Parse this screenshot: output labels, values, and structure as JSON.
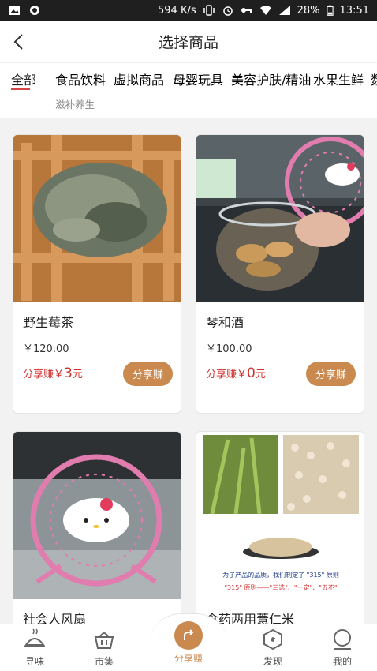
{
  "status_bar": {
    "speed": "594 K/s",
    "battery": "28%",
    "time": "13:51"
  },
  "header": {
    "title": "选择商品"
  },
  "tabs": [
    {
      "label": "全部"
    },
    {
      "label": "食品饮料"
    },
    {
      "label": "虚拟商品"
    },
    {
      "label": "母婴玩具"
    },
    {
      "label": "美容护肤/精油"
    },
    {
      "label": "水果生鲜"
    },
    {
      "label": "数"
    }
  ],
  "tab_row2": {
    "label": "滋补养生"
  },
  "products": [
    {
      "name": "野生莓茶",
      "price": "￥120.00",
      "share_prefix": "分享赚￥",
      "share_amount": "3",
      "share_suffix": "元",
      "button": "分享赚"
    },
    {
      "name": "琴和酒",
      "price": "￥100.00",
      "share_prefix": "分享赚￥",
      "share_amount": "0",
      "share_suffix": "元",
      "button": "分享赚"
    },
    {
      "name": "社会人风扇"
    },
    {
      "name": "食药两用薏仁米"
    }
  ],
  "product4_caption": {
    "line1": "为了产品的品质，我们制定了 \"315\" 原则",
    "line2": "\"315\" 原则——\"三选\"、\"一定\"、\"五不\""
  },
  "bottom_nav": [
    {
      "label": "寻味"
    },
    {
      "label": "市集"
    },
    {
      "label": "分享赚"
    },
    {
      "label": "发现"
    },
    {
      "label": "我的"
    }
  ],
  "colors": {
    "accent": "#c9894f",
    "red": "#d0312d",
    "tab_underline": "#d64545"
  }
}
